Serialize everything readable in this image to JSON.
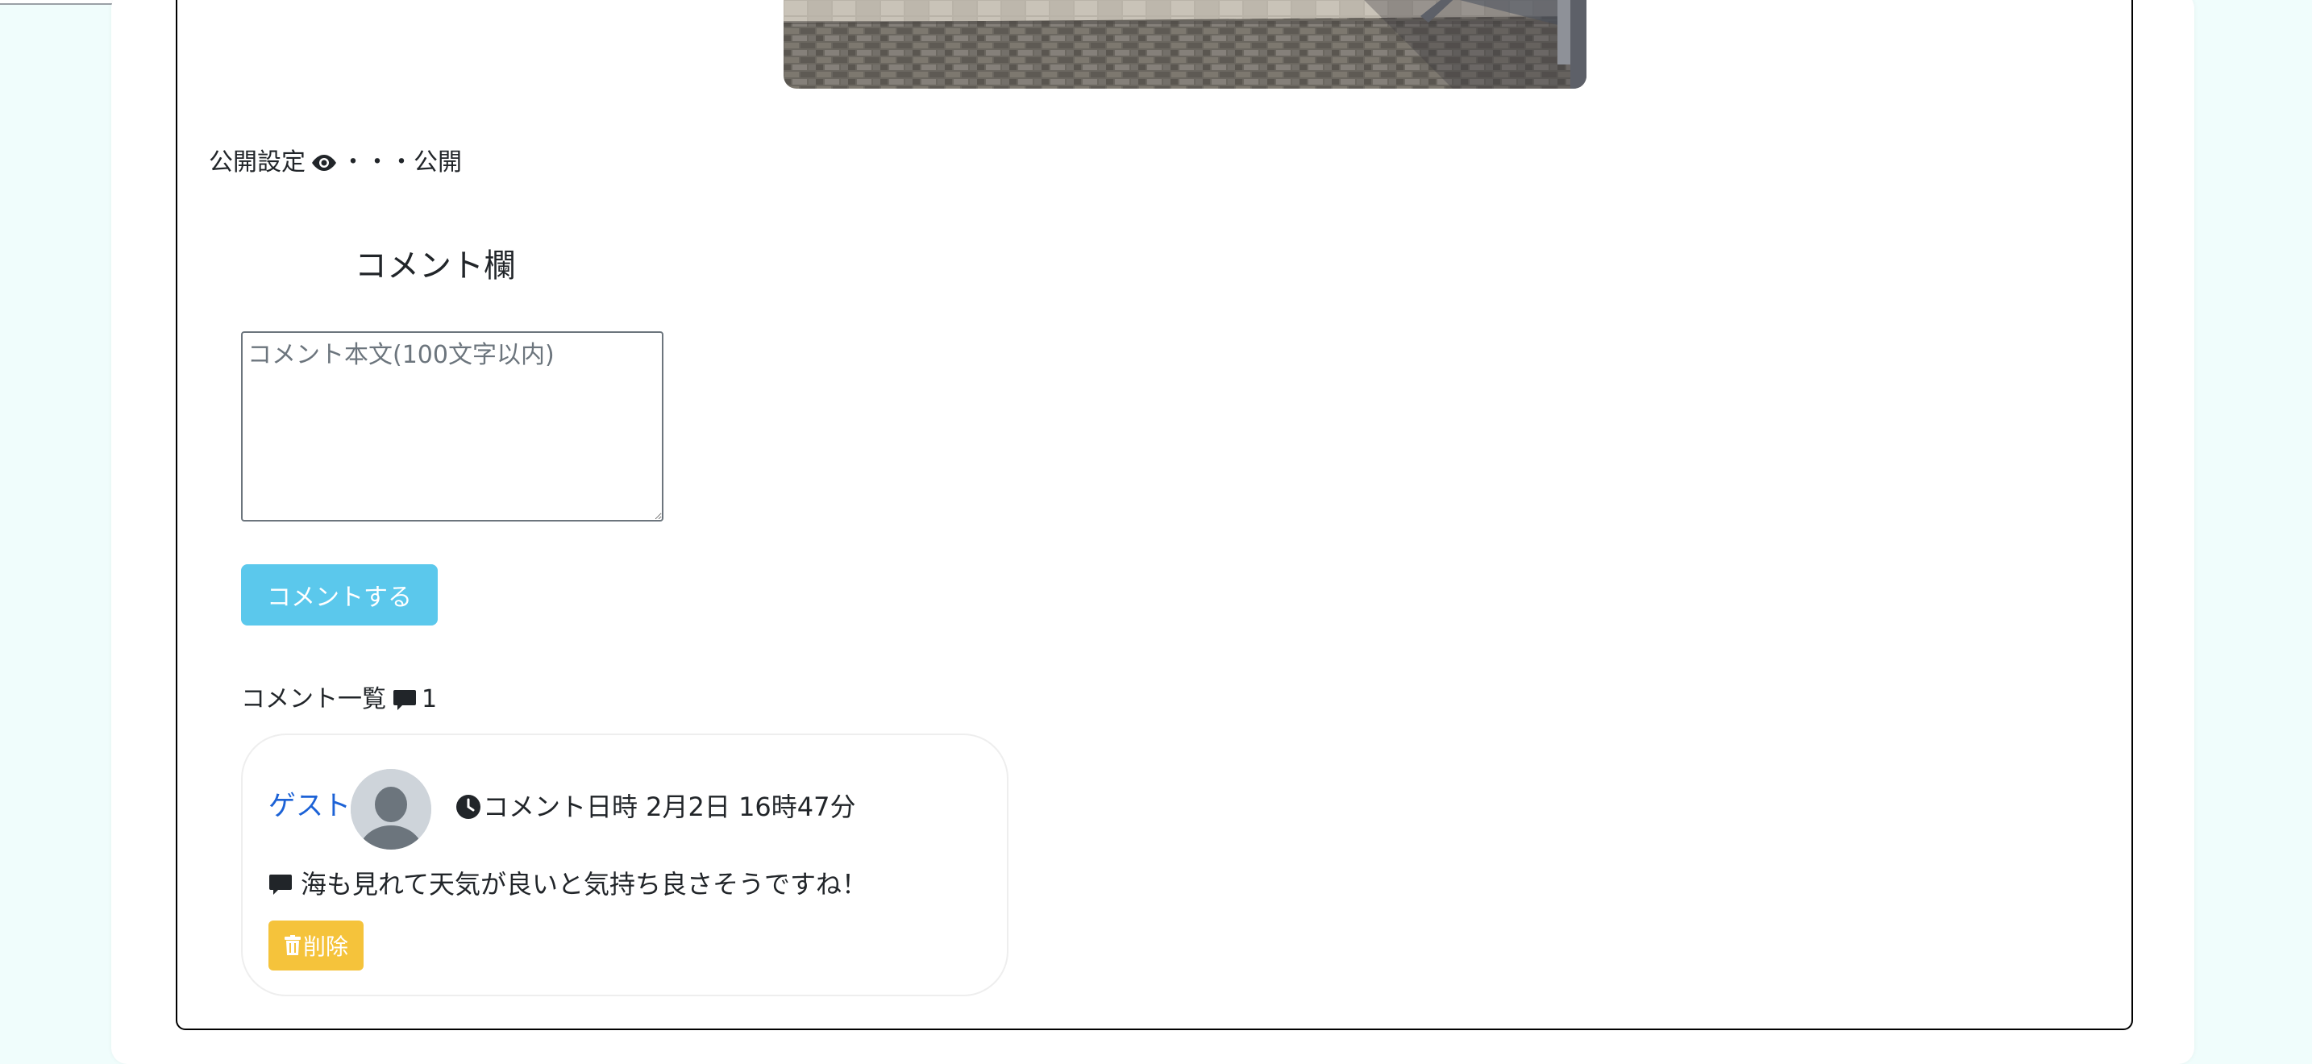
{
  "post": {
    "visibility_label": "公開設定",
    "visibility_dots": "・・・",
    "visibility_value": "公開",
    "visibility_icon": "eye-icon"
  },
  "comment_form": {
    "heading": "コメント欄",
    "placeholder": "コメント本文(100文字以内)",
    "value": "",
    "submit_label": "コメントする",
    "submit_color": "#5bc8ec"
  },
  "comment_list": {
    "title": "コメント一覧",
    "count": "1",
    "icon": "comment-icon"
  },
  "comments": [
    {
      "author": "ゲスト",
      "avatar_icon": "default-avatar-icon",
      "time_icon": "clock-icon",
      "datetime_label": "コメント日時 2月2日 16時47分",
      "body_icon": "comment-icon",
      "body": "海も見れて天気が良いと気持ち良さそうですね！",
      "delete_label": "削除",
      "delete_icon": "trash-icon",
      "delete_color": "#f5c33b",
      "author_color": "#1c62d6"
    }
  ],
  "colors": {
    "page_background": "#f0fdfc",
    "panel_background": "#ffffff",
    "card_border": "#000000"
  }
}
